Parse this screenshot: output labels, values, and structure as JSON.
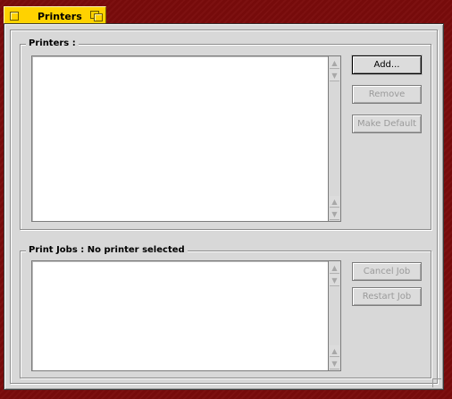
{
  "window": {
    "title": "Printers"
  },
  "printers_group": {
    "label": "Printers :",
    "items": [],
    "buttons": {
      "add": "Add...",
      "remove": "Remove",
      "make_default": "Make Default"
    }
  },
  "jobs_group": {
    "label": "Print Jobs : No printer selected",
    "items": [],
    "buttons": {
      "cancel_job": "Cancel Job",
      "restart_job": "Restart Job"
    }
  },
  "colors": {
    "desktop": "#7a0b0b",
    "tab": "#ffd200",
    "panel": "#d8d8d8"
  },
  "icons": {
    "close": "close-box-icon",
    "zoom": "zoom-box-icon",
    "up": "triangle-up",
    "down": "triangle-down"
  }
}
